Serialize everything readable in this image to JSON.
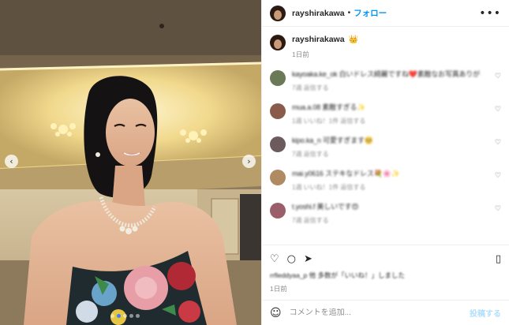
{
  "header": {
    "username": "rayshirakawa",
    "separator": "•",
    "follow_label": "フォロー",
    "more_icon": "more-horizontal-icon"
  },
  "caption": {
    "username": "rayshirakawa",
    "emoji": "👑",
    "time": "1日前"
  },
  "comments": [
    {
      "text": "kayoaka.ke_ok 白いドレス綺麗ですね❤️素敵なお写真ありがとうございます",
      "meta": "7週  返信する",
      "avatar_color": "#6b7a56"
    },
    {
      "text": "mua.a.08 素敵すぎる✨",
      "meta": "1週 いいね！1件  返信する",
      "avatar_color": "#8a5a4a"
    },
    {
      "text": "kipo.ka_n 可愛すぎます🥺",
      "meta": "7週  返信する",
      "avatar_color": "#6c5b5e"
    },
    {
      "text": "mai.y0616 ステキなドレス💐🌸✨",
      "meta": "1週 いいね！1件  返信する",
      "avatar_color": "#b08a62"
    },
    {
      "text": "t.yoshi.f 美しいです😍",
      "meta": "7週  返信する",
      "avatar_color": "#9a5f6a"
    }
  ],
  "actions": {
    "like_icon": "heart-icon",
    "comment_icon": "comment-icon",
    "share_icon": "share-icon",
    "save_icon": "bookmark-icon",
    "likes_text": "rrfleddyaa_p 他 多数が「いいね！」しました",
    "post_time": "1日前"
  },
  "add_comment": {
    "emoji_icon": "smiley-icon",
    "placeholder": "コメントを追加...",
    "post_label": "投稿する"
  },
  "carousel": {
    "prev_icon": "chevron-left-icon",
    "next_icon": "chevron-right-icon",
    "slide_count": 5,
    "active_index": 1
  },
  "colors": {
    "accent": "#0095f6",
    "post_disabled": "#b2dffc",
    "muted": "#8e8e8e"
  }
}
